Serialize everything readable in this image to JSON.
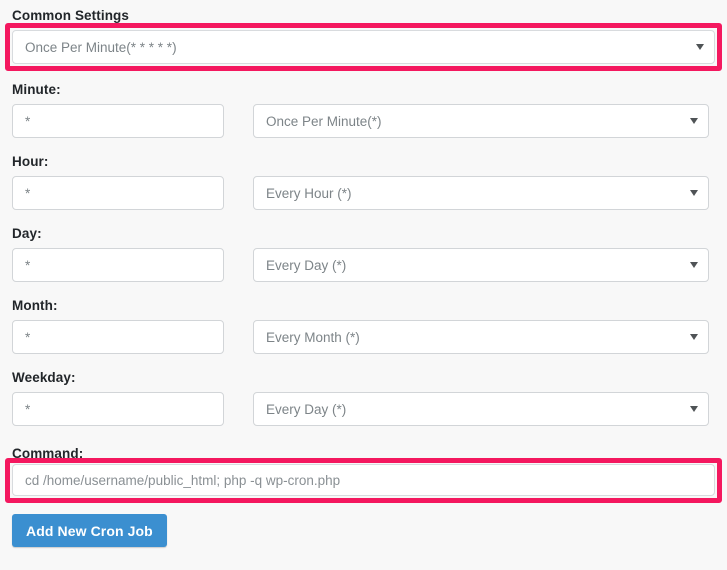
{
  "colors": {
    "background": "#f8f8f8",
    "highlight": "#f4185f",
    "button": "#3b8fd0",
    "label_text": "#22262a",
    "input_text": "#7d8488",
    "border": "#d2d5d8"
  },
  "form": {
    "common_settings": {
      "label": "Common Settings",
      "selected": "Once Per Minute(* * * * *)",
      "highlighted": true
    },
    "rows": [
      {
        "label": "Minute:",
        "value": "*",
        "select_value": "Once Per Minute(*)"
      },
      {
        "label": "Hour:",
        "value": "*",
        "select_value": "Every Hour (*)"
      },
      {
        "label": "Day:",
        "value": "*",
        "select_value": "Every Day (*)"
      },
      {
        "label": "Month:",
        "value": "*",
        "select_value": "Every Month (*)"
      },
      {
        "label": "Weekday:",
        "value": "*",
        "select_value": "Every Day (*)"
      }
    ],
    "command": {
      "label": "Command:",
      "value": "cd /home/username/public_html; php -q wp-cron.php",
      "highlighted": true
    },
    "submit": {
      "label": "Add New Cron Job"
    }
  },
  "icons": {
    "caret": "chevron-down-icon"
  }
}
